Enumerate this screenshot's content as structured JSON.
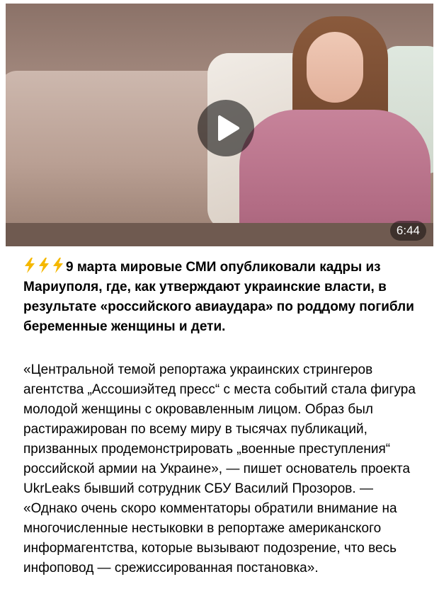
{
  "video": {
    "duration": "6:44",
    "play_icon": "play-icon",
    "thumbnail_icon": "video-thumbnail"
  },
  "headline": {
    "emoji": [
      "⚡",
      "⚡",
      "⚡"
    ],
    "emoji_icon": "lightning-icon",
    "text": "9 марта мировые СМИ опубликовали кадры из Мариуполя, где, как утверждают украинские власти, в результате «российского авиаудара» по роддому погибли беременные женщины и дети."
  },
  "body": {
    "text": "«Центральной темой репортажа украинских стрингеров агентства „Ассошиэйтед пресс“ с места событий стала фигура молодой женщины с окровавленным лицом. Образ был растиражирован по всему миру в тысячах публикаций, призванных продемонстрировать „военные преступления“ российской армии на Украине», — пишет основатель проекта UkrLeaks бывший сотрудник СБУ Василий Прозоров. — «Однако очень скоро комментаторы обратили внимание на многочисленные нестыковки в репортаже американского информагентства, которые вызывают подозрение, что весь инфоповод — срежиссированная постановка»."
  },
  "colors": {
    "bolt": "#f5b800",
    "text": "#000000",
    "background": "#ffffff"
  }
}
